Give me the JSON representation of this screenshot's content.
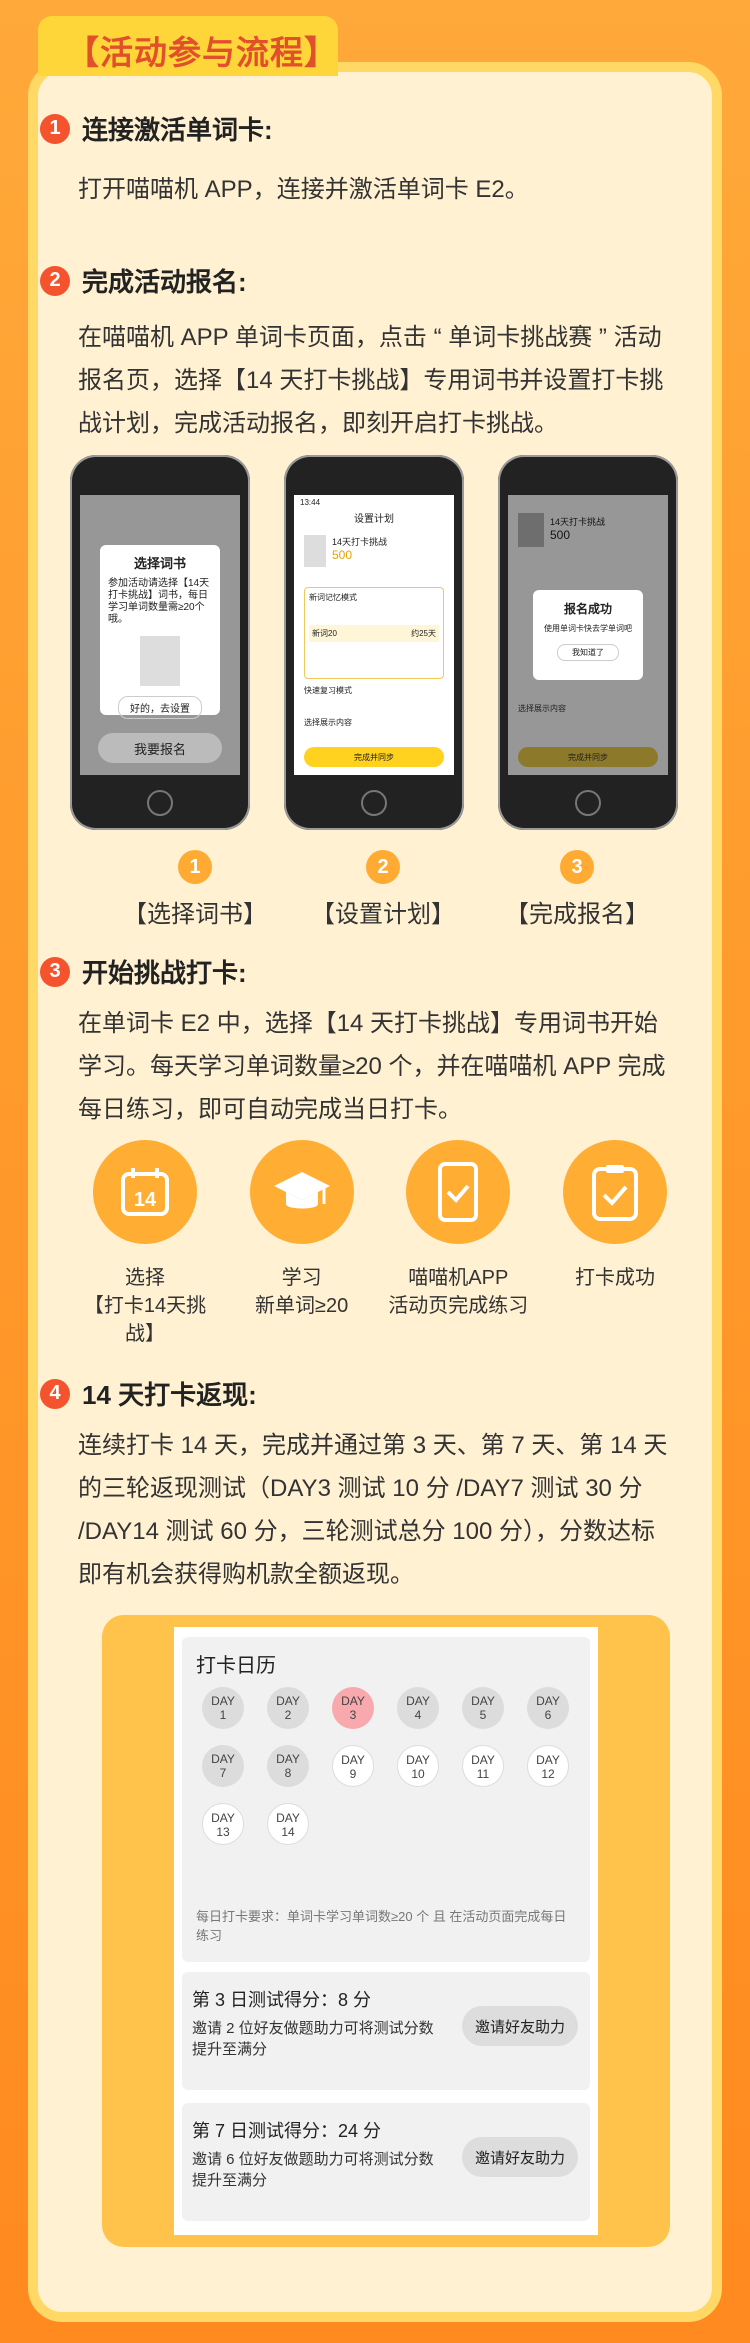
{
  "header": {
    "title": "【活动参与流程】"
  },
  "steps": [
    {
      "num": "1",
      "title": "连接激活单词卡:",
      "desc": "打开喵喵机 APP，连接并激活单词卡 E2。"
    },
    {
      "num": "2",
      "title": "完成活动报名:",
      "desc": "在喵喵机 APP 单词卡页面，点击 “ 单词卡挑战赛 ” 活动报名页，选择【14 天打卡挑战】专用词书并设置打卡挑战计划，完成活动报名，即刻开启打卡挑战。"
    },
    {
      "num": "3",
      "title": "开始挑战打卡:",
      "desc": "在单词卡 E2 中，选择【14 天打卡挑战】专用词书开始学习。每天学习单词数量≥20 个，并在喵喵机 APP 完成每日练习，即可自动完成当日打卡。"
    },
    {
      "num": "4",
      "title": "14 天打卡返现:",
      "desc": "连续打卡 14 天，完成并通过第 3 天、第 7 天、第 14 天的三轮返现测试（DAY3 测试 10 分 /DAY7 测试 30 分 /DAY14 测试 60 分，三轮测试总分 100 分），分数达标即有机会获得购机款全额返现。"
    }
  ],
  "phones": [
    {
      "num": "1",
      "label": "【选择词书】",
      "screen_title": "选择词书",
      "screen_text": "参加活动请选择【14天打卡挑战】词书，每日学习单词数量需≥20个哦。",
      "confirm": "好的，去设置",
      "bottom_btn": "我要报名"
    },
    {
      "num": "2",
      "label": "【设置计划】",
      "time": "13:44",
      "screen_title": "设置计划",
      "book": "14天打卡挑战",
      "count": "500",
      "mode1": "新词记忆模式",
      "row_a": "新词20",
      "row_b": "约25天",
      "mode2": "快速复习模式",
      "display": "选择展示内容",
      "done": "完成并同步"
    },
    {
      "num": "3",
      "label": "【完成报名】",
      "book": "14天打卡挑战",
      "count": "500",
      "success": "报名成功",
      "success_text": "使用单词卡快去学单词吧",
      "ok": "我知道了",
      "display": "选择展示内容",
      "done": "完成并同步"
    }
  ],
  "flow": [
    {
      "label": "选择\n【打卡14天挑战】",
      "icon": "calendar-14-icon",
      "icon_text": "14"
    },
    {
      "label": "学习\n新单词≥20",
      "icon": "graduation-cap-icon"
    },
    {
      "label": "喵喵机APP\n活动页完成练习",
      "icon": "phone-check-icon"
    },
    {
      "label": "打卡成功",
      "icon": "clipboard-check-icon"
    }
  ],
  "calendar": {
    "title": "打卡日历",
    "days": [
      {
        "top": "DAY",
        "bottom": "1"
      },
      {
        "top": "DAY",
        "bottom": "2"
      },
      {
        "top": "DAY",
        "bottom": "3"
      },
      {
        "top": "DAY",
        "bottom": "4"
      },
      {
        "top": "DAY",
        "bottom": "5"
      },
      {
        "top": "DAY",
        "bottom": "6"
      },
      {
        "top": "DAY",
        "bottom": "7"
      },
      {
        "top": "DAY",
        "bottom": "8"
      },
      {
        "top": "DAY",
        "bottom": "9"
      },
      {
        "top": "DAY",
        "bottom": "10"
      },
      {
        "top": "DAY",
        "bottom": "11"
      },
      {
        "top": "DAY",
        "bottom": "12"
      },
      {
        "top": "DAY",
        "bottom": "13"
      },
      {
        "top": "DAY",
        "bottom": "14"
      }
    ],
    "note": "每日打卡要求：单词卡学习单词数≥20 个 且 在活动页面完成每日练习",
    "scores": [
      {
        "title": "第 3 日测试得分：8 分",
        "desc": "邀请 2 位好友做题助力可将测试分数提升至满分",
        "button": "邀请好友助力"
      },
      {
        "title": "第 7 日测试得分：24 分",
        "desc": "邀请 6 位好友做题助力可将测试分数提升至满分",
        "button": "邀请好友助力"
      }
    ]
  }
}
